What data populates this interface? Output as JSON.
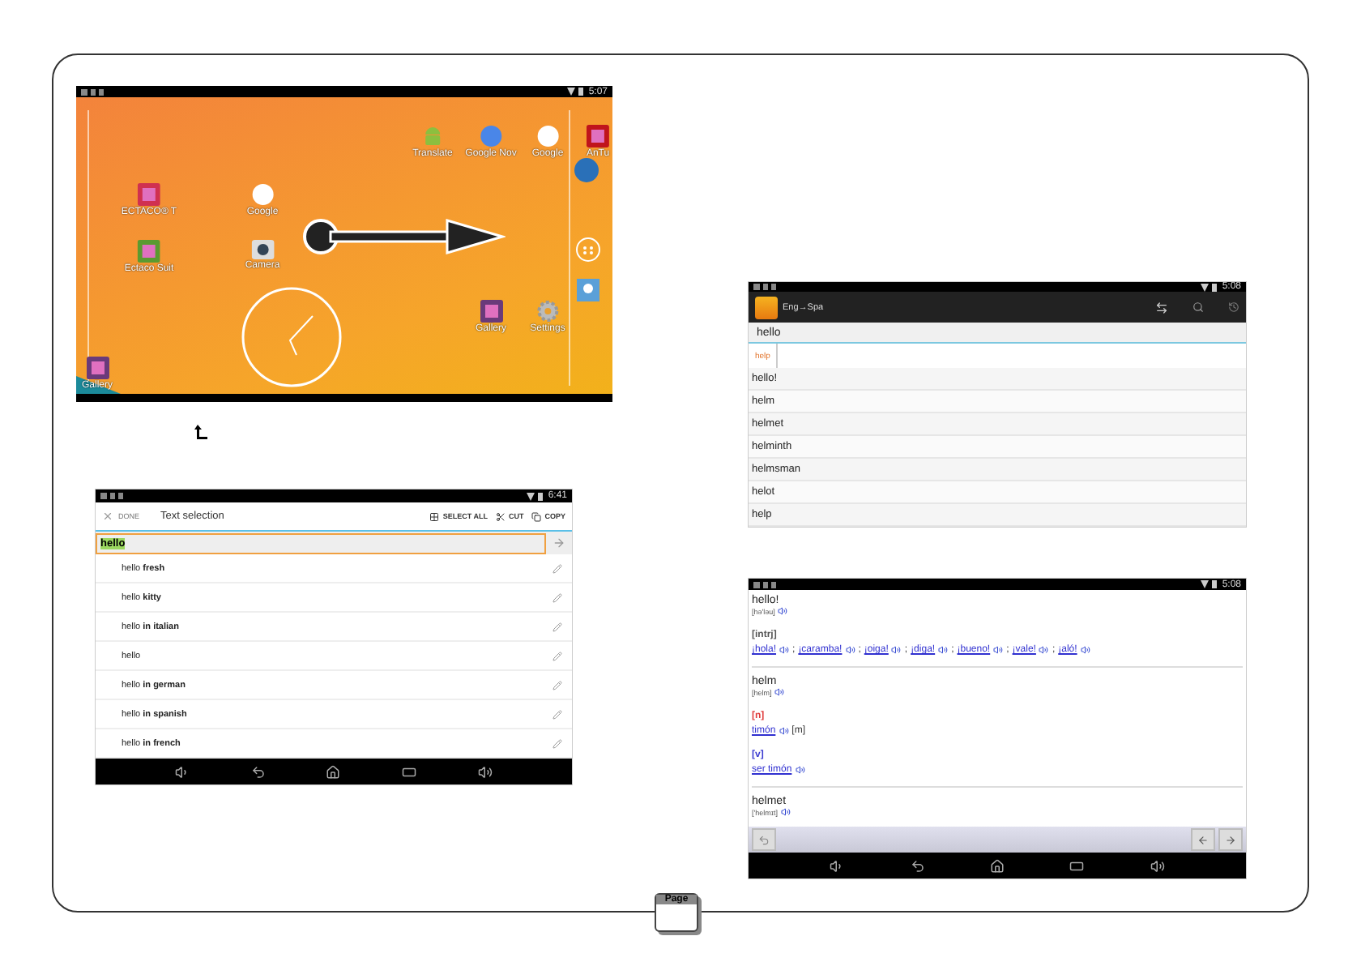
{
  "home_screen": {
    "status_time": "5:07",
    "apps": [
      {
        "label": "Translate",
        "kind": "android"
      },
      {
        "label": "Google Nov",
        "kind": "google-now"
      },
      {
        "label": "Google",
        "kind": "google"
      },
      {
        "label": "AnTu",
        "kind": "antutu"
      },
      {
        "label": "ECTACO® T",
        "kind": "ectaco"
      },
      {
        "label": "Google",
        "kind": "google"
      },
      {
        "label": "Ectaco Suit",
        "kind": "suite"
      },
      {
        "label": "Camera",
        "kind": "camera"
      },
      {
        "label": "Gallery",
        "kind": "gallery"
      },
      {
        "label": "Settings",
        "kind": "settings"
      },
      {
        "label": "Gallery",
        "kind": "gallery"
      }
    ]
  },
  "selection_screen": {
    "status_time": "6:41",
    "done": "DONE",
    "title": "Text selection",
    "actions": [
      "SELECT ALL",
      "CUT",
      "COPY"
    ],
    "query": "hello",
    "suggestions": [
      "hello **fresh**",
      "hello **kitty**",
      "hello **in italian**",
      "hello",
      "hello **in german**",
      "hello **in spanish**",
      "hello **in french**"
    ]
  },
  "dictionary_search": {
    "status_time": "5:08",
    "title": "Eng→Spa",
    "query": "hello",
    "tabs": [
      {
        "label": "help",
        "selected": true
      }
    ],
    "words": [
      "hello!",
      "helm",
      "helmet",
      "helminth",
      "helmsman",
      "helot",
      "help"
    ]
  },
  "dictionary_entry": {
    "status_time": "5:08",
    "separator": ";",
    "entries": [
      {
        "headword": "hello!",
        "transcription": "[hə'ləu]",
        "senses": [
          {
            "pos": "[intrj]",
            "color": "#555555",
            "translations": [
              "¡hola!",
              "¡caramba!",
              "¡oiga!",
              "¡diga!",
              "¡bueno!",
              "¡vale!",
              "¡aló!"
            ]
          }
        ]
      },
      {
        "headword": "helm",
        "transcription": "[helm]",
        "senses": [
          {
            "pos": "[n]",
            "color": "#e03c3c",
            "translations": [
              "timón"
            ],
            "gender": "[m]"
          },
          {
            "pos": "[v]",
            "color": "#3a3ad0",
            "translations": [
              "ser timón"
            ]
          }
        ]
      },
      {
        "headword": "helmet",
        "transcription": "['helmɪt]"
      }
    ]
  },
  "page_tab": {
    "label": "Page"
  }
}
